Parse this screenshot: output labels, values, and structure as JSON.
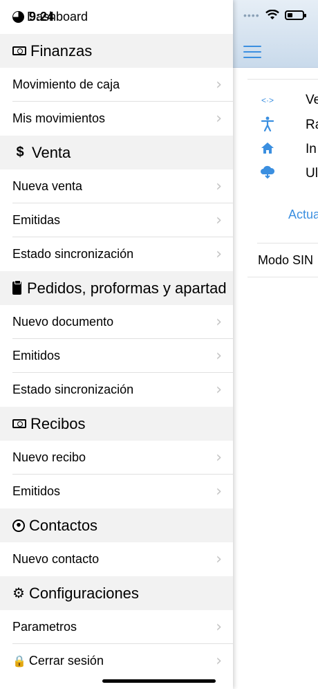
{
  "status": {
    "time": "9:24"
  },
  "dashboard": {
    "label": "Dashboard"
  },
  "sections": [
    {
      "id": "finanzas",
      "icon": "money-icon",
      "title": "Finanzas",
      "items": [
        "Movimiento de caja",
        "Mis movimientos"
      ]
    },
    {
      "id": "venta",
      "icon": "dollar-icon",
      "title": "Venta",
      "items": [
        "Nueva venta",
        "Emitidas",
        "Estado sincronización"
      ]
    },
    {
      "id": "pedidos",
      "icon": "clipboard-icon",
      "title": "Pedidos, proformas y apartad",
      "items": [
        "Nuevo documento",
        "Emitidos",
        "Estado sincronización"
      ]
    },
    {
      "id": "recibos",
      "icon": "money-icon",
      "title": "Recibos",
      "items": [
        "Nuevo recibo",
        "Emitidos"
      ]
    },
    {
      "id": "contactos",
      "icon": "contacts-icon",
      "title": "Contactos",
      "items": [
        "Nuevo contacto"
      ]
    },
    {
      "id": "config",
      "icon": "gear-icon",
      "title": "Configuraciones",
      "items": [
        "Parametros",
        "Cerrar sesión"
      ]
    }
  ],
  "background": {
    "rows": [
      "Ve",
      "Ra",
      "In",
      "Ul"
    ],
    "row_icons": [
      "code-icon",
      "accessibility-icon",
      "home-icon",
      "cloud-download-icon"
    ],
    "update_link": "Actua",
    "mode_text": "Modo SIN"
  },
  "accent": "#3b8fe0",
  "dollar_glyph": "$"
}
